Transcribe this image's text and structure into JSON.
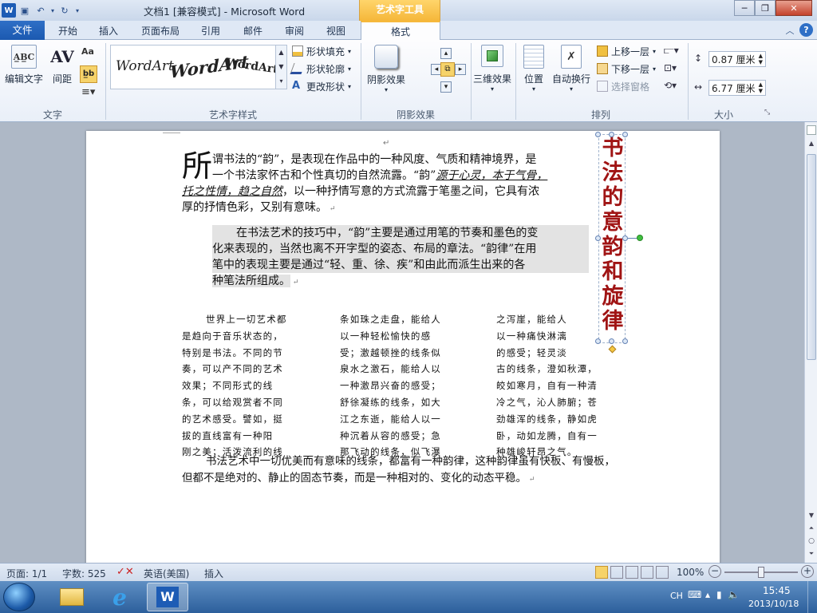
{
  "app": {
    "doc_title": "文档1 [兼容模式] - Microsoft Word",
    "context_tool": "艺术字工具"
  },
  "tabs": {
    "file": "文件",
    "items": [
      "开始",
      "插入",
      "页面布局",
      "引用",
      "邮件",
      "审阅",
      "视图"
    ],
    "format": "格式"
  },
  "ribbon": {
    "text_group": {
      "edit_text": "编辑文字",
      "spacing": "间距",
      "label": "文字"
    },
    "wordart_styles": {
      "samples": [
        "WordArt",
        "WordArt",
        "WordArt"
      ],
      "shape_fill": "形状填充",
      "shape_outline": "形状轮廓",
      "change_shape": "更改形状",
      "label": "艺术字样式"
    },
    "shadow": {
      "shadow_effect": "阴影效果",
      "label": "阴影效果"
    },
    "threed": {
      "effect": "三维效果"
    },
    "arrange": {
      "position": "位置",
      "wrap": "自动换行",
      "bring_forward": "上移一层",
      "send_backward": "下移一层",
      "selection_pane": "选择窗格",
      "label": "排列"
    },
    "size": {
      "height": "0.87 厘米",
      "width": "6.77 厘米",
      "label": "大小"
    }
  },
  "document": {
    "dropcap": "所",
    "p1_line1": "谓书法的“韵”，是表现在作品中的一种风度、气质和精神境界，是",
    "p1_line2a": "一个书法家怀古和个性真切的自然流露。“韵”",
    "p1_line2b": "源于心灵，本于气骨，",
    "p1_line3a": "托之性情，趋之自然",
    "p1_line3b": "，以一种抒情写意的方式流露于笔墨之间，它具有浓",
    "p1_line4": "厚的抒情色彩，又别有意味。",
    "p2_lines": [
      "在书法艺术的技巧中，“韵”主要是通过用笔的节奏和墨色的变",
      "化来表现的，当然也离不开字型的姿态、布局的章法。“韵律”在用",
      "笔中的表现主要是通过“轻、重、徐、疾”和由此而派生出来的各",
      "种笔法所组成。"
    ],
    "col1": [
      "世界上一切艺术都",
      "是趋向于音乐状态的，",
      "特别是书法。不同的节",
      "奏，可以产不同的艺术",
      "效果；不同形式的线",
      "条，可以给观赏者不同",
      "的艺术感受。譬如，挺",
      "拔的直线富有一种阳",
      "刚之美；活泼流利的线"
    ],
    "col2": [
      "条如珠之走盘，能给人",
      "以一种轻松愉快的感",
      "受；激越顿挫的线条似",
      "泉水之激石，能给人以",
      "一种激昂兴奋的感受；",
      "舒徐凝练的线条，如大",
      "江之东逝，能给人以一",
      "种沉着从容的感受；急",
      "那飞动的线条，似飞瀑"
    ],
    "col3": [
      "之泻崖，能给人",
      "以一种痛快淋漓",
      "的感受；轻灵淡",
      "古的线条，澄如秋潭，",
      "皎如寒月，自有一种清",
      "冷之气，沁人肺腑；苍",
      "劲雄浑的线条，静如虎",
      "卧，动如龙腾，自有一",
      "种雄峻轩昂之气。"
    ],
    "p4_line1": "书法艺术中一切优美而有意味的线条，都富有一种韵律，这种韵律虽有快板、有慢板，",
    "p4_line2": "但都不是绝对的、静止的固态节奏，而是一种相对的、变化的动态平稳。",
    "vertical_title": [
      "书",
      "法",
      "的",
      "意",
      "韵",
      "和",
      "旋",
      "律"
    ]
  },
  "status": {
    "page": "页面: 1/1",
    "words": "字数: 525",
    "lang": "英语(美国)",
    "mode": "插入",
    "zoom": "100%"
  },
  "taskbar": {
    "ime": "CH",
    "time": "15:45",
    "date": "2013/10/18"
  }
}
